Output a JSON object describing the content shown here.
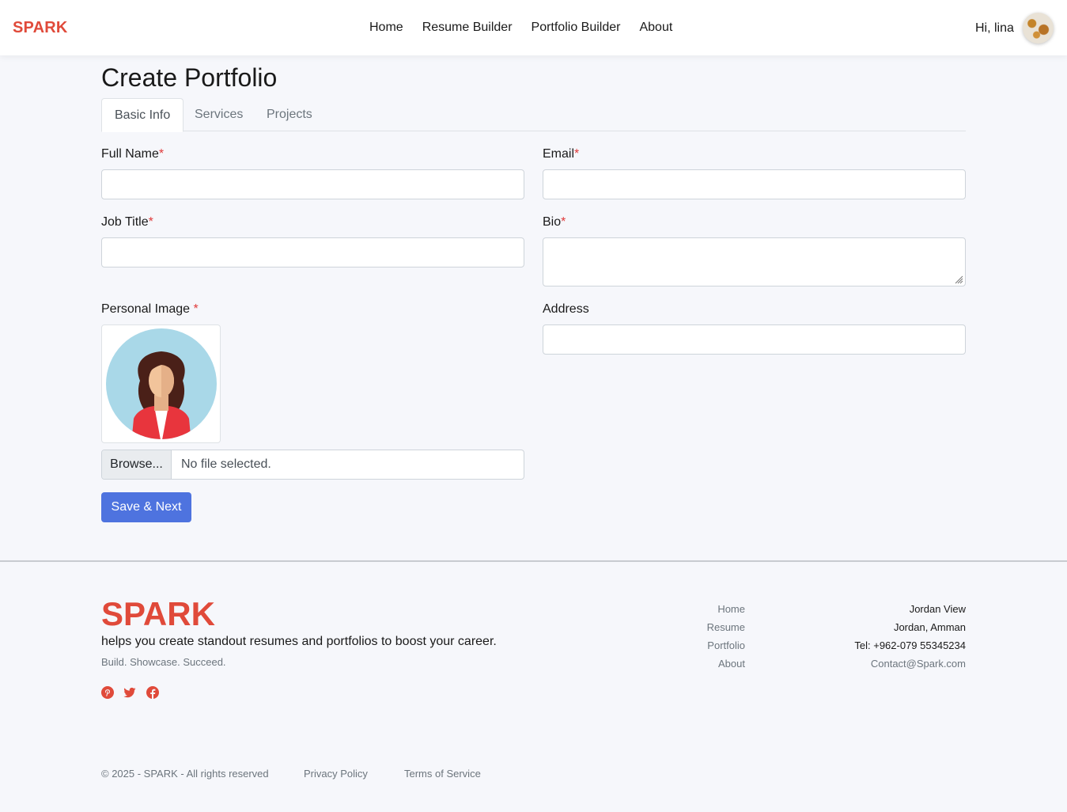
{
  "nav": {
    "brand": "SPARK",
    "links": [
      "Home",
      "Resume Builder",
      "Portfolio Builder",
      "About"
    ],
    "greeting": "Hi, lina"
  },
  "page": {
    "title": "Create Portfolio",
    "tabs": [
      "Basic Info",
      "Services",
      "Projects"
    ],
    "active_tab": "Basic Info"
  },
  "form": {
    "required_marker": "*",
    "full_name": {
      "label": "Full Name",
      "value": ""
    },
    "email": {
      "label": "Email",
      "value": ""
    },
    "job_title": {
      "label": "Job Title",
      "value": ""
    },
    "bio": {
      "label": "Bio",
      "value": ""
    },
    "personal_image": {
      "label": "Personal Image "
    },
    "address": {
      "label": "Address",
      "value": ""
    },
    "file": {
      "browse_label": "Browse...",
      "status": "No file selected."
    },
    "submit_label": "Save & Next"
  },
  "footer": {
    "brand": "SPARK",
    "tagline": "helps you create standout resumes and portfolios to boost your career.",
    "motto": "Build. Showcase. Succeed.",
    "social_icons": [
      "pinterest-icon",
      "twitter-icon",
      "facebook-icon"
    ],
    "links": [
      "Home",
      "Resume",
      "Portfolio",
      "About"
    ],
    "contact": {
      "line1": "Jordan View",
      "line2": "Jordan, Amman",
      "phone": "Tel: +962-079 55345234",
      "email": "Contact@Spark.com"
    },
    "copyright": "© 2025 - SPARK - All rights reserved",
    "privacy": "Privacy Policy",
    "terms": "Terms of Service"
  },
  "colors": {
    "brand": "#e04a3a",
    "primary_button": "#4e73df",
    "background": "#f6f7fb"
  }
}
